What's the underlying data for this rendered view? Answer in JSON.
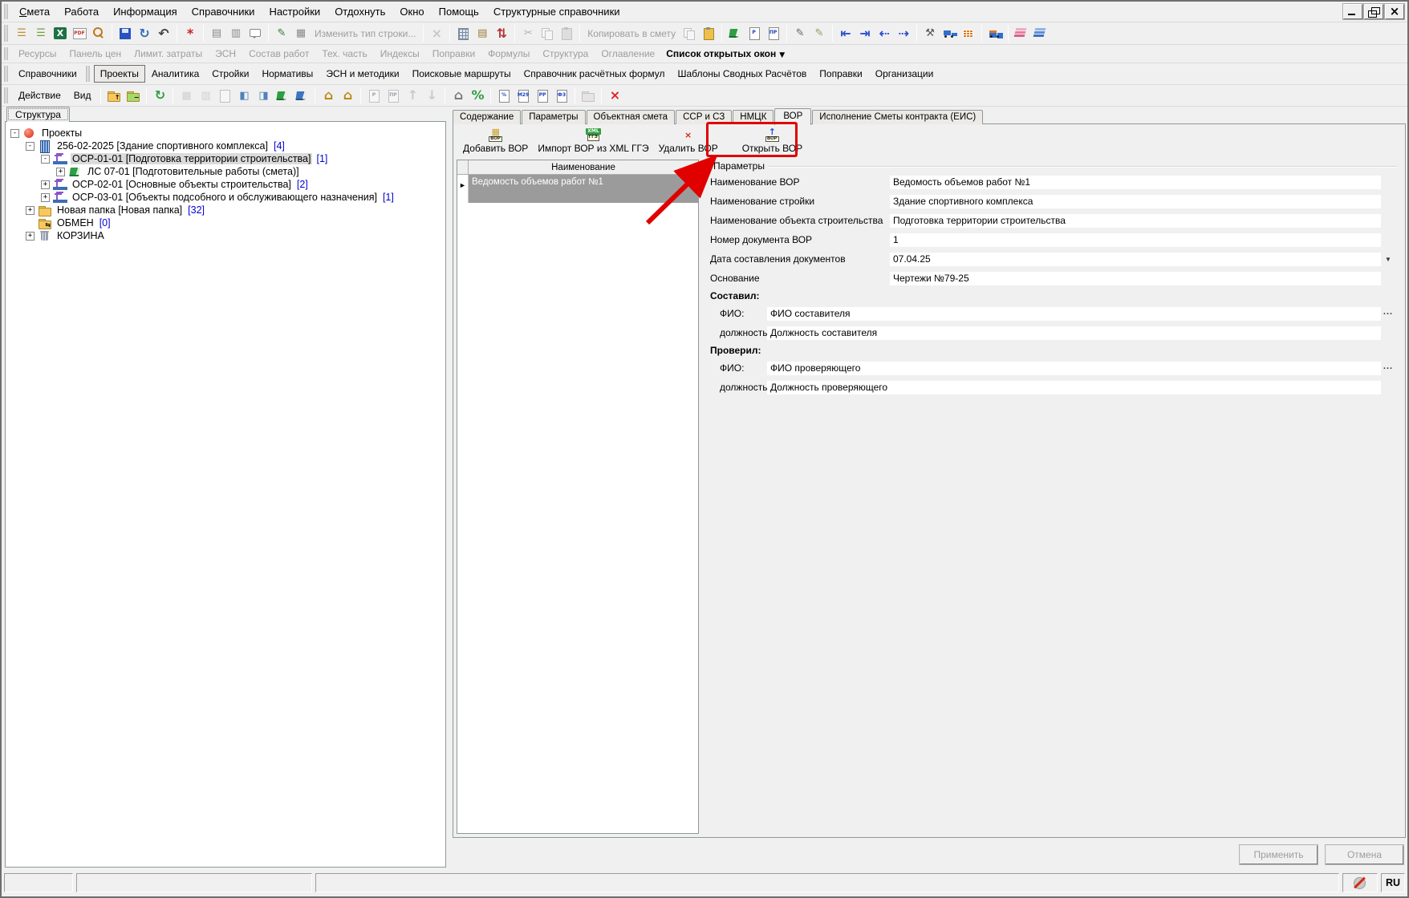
{
  "window": {
    "controls": [
      {
        "name": "minimize-button"
      },
      {
        "name": "restore-button"
      },
      {
        "name": "close-button"
      }
    ]
  },
  "menubar": {
    "items": [
      {
        "label": "Смета",
        "hotkey": true
      },
      {
        "label": "Работа"
      },
      {
        "label": "Информация"
      },
      {
        "label": "Справочники"
      },
      {
        "label": "Настройки"
      },
      {
        "label": "Отдохнуть"
      },
      {
        "label": "Окно"
      },
      {
        "label": "Помощь"
      },
      {
        "label": "Структурные справочники"
      }
    ]
  },
  "toolbar1": {
    "groups": [
      {
        "items": [
          {
            "icon": "tree-export-icon"
          },
          {
            "icon": "tree-import-icon"
          },
          {
            "icon": "excel-icon"
          },
          {
            "icon": "pdf-icon"
          },
          {
            "icon": "search-icon"
          }
        ]
      },
      {
        "items": [
          {
            "icon": "save-icon"
          },
          {
            "icon": "refresh-icon"
          },
          {
            "icon": "undo-icon"
          }
        ]
      },
      {
        "items": [
          {
            "icon": "recalc-icon"
          }
        ]
      },
      {
        "items": [
          {
            "icon": "row-settings-icon"
          },
          {
            "icon": "row-settings-alt-icon"
          },
          {
            "icon": "comment-icon"
          }
        ]
      },
      {
        "items": [
          {
            "icon": "globe-edit-icon"
          },
          {
            "icon": "building-copy-icon"
          },
          {
            "label": "Изменить тип строки...",
            "disabled": true
          }
        ]
      },
      {
        "items": [
          {
            "icon": "delete-row-icon",
            "disabled": true
          }
        ]
      },
      {
        "items": [
          {
            "icon": "calc-icon"
          },
          {
            "icon": "page-edit-icon"
          },
          {
            "icon": "updown-icon"
          }
        ]
      },
      {
        "items": [
          {
            "icon": "cut-icon",
            "disabled": true
          },
          {
            "icon": "copy-icon",
            "disabled": true
          },
          {
            "icon": "paste-icon",
            "disabled": true
          }
        ]
      },
      {
        "items": [
          {
            "label": "Копировать в смету",
            "disabled": true
          },
          {
            "icon": "copy-page-icon",
            "disabled": true
          },
          {
            "icon": "paste-orange-icon"
          }
        ]
      },
      {
        "items": [
          {
            "icon": "book-settings-icon"
          },
          {
            "icon": "page-p-icon",
            "letter": "P"
          },
          {
            "icon": "page-pr-icon",
            "letter": "ПР"
          }
        ]
      },
      {
        "items": [
          {
            "icon": "edit-list-icon"
          },
          {
            "icon": "edit-list-remove-icon"
          }
        ]
      },
      {
        "items": [
          {
            "icon": "level-up-icon"
          },
          {
            "icon": "level-down-icon"
          },
          {
            "icon": "outdent-icon"
          },
          {
            "icon": "indent-icon"
          }
        ]
      },
      {
        "items": [
          {
            "icon": "labor-icon"
          },
          {
            "icon": "machines-icon"
          },
          {
            "icon": "materials-icon"
          }
        ]
      },
      {
        "items": [
          {
            "icon": "delivery-icon"
          }
        ]
      },
      {
        "items": [
          {
            "icon": "books-pink-icon"
          },
          {
            "icon": "books-blue-icon"
          }
        ]
      }
    ]
  },
  "toolbar2": {
    "items": [
      "Ресурсы",
      "Панель цен",
      "Лимит. затраты",
      "ЭСН",
      "Состав работ",
      "Тех. часть",
      "Индексы",
      "Поправки",
      "Формулы",
      "Структура",
      "Оглавление"
    ],
    "open_windows": "Список открытых окон"
  },
  "main_tabs": {
    "items": [
      "Справочники",
      "Проекты",
      "Аналитика",
      "Стройки",
      "Нормативы",
      "ЭСН и методики",
      "Поисковые маршруты",
      "Справочник расчётных формул",
      "Шаблоны Сводных Расчётов",
      "Поправки",
      "Организации"
    ],
    "active": "Проекты"
  },
  "action_bar": {
    "menus": [
      "Действие",
      "Вид"
    ],
    "groups": [
      [
        {
          "icon": "folder-up-icon",
          "overlay": "↑"
        },
        {
          "icon": "folder-collapse-icon",
          "overlay": "−"
        }
      ],
      [
        {
          "icon": "refresh-green-icon"
        }
      ],
      [
        {
          "icon": "building-gray-icon",
          "disabled": true
        },
        {
          "icon": "columns-icon",
          "disabled": true
        },
        {
          "icon": "page-gray-icon",
          "disabled": true
        },
        {
          "icon": "window-edit-icon"
        },
        {
          "icon": "window-export-icon"
        },
        {
          "icon": "book-green-icon"
        },
        {
          "icon": "book-export-icon"
        }
      ],
      [
        {
          "icon": "house-add-icon"
        },
        {
          "icon": "house-copy-icon"
        }
      ],
      [
        {
          "icon": "page-p2-icon",
          "letter": "P",
          "disabled": true
        },
        {
          "icon": "page-pr2-icon",
          "letter": "ПР",
          "disabled": true
        },
        {
          "icon": "move-up-icon",
          "disabled": true
        },
        {
          "icon": "move-down-icon",
          "disabled": true
        }
      ],
      [
        {
          "icon": "house-percent-icon"
        },
        {
          "icon": "percent-gear-icon"
        }
      ],
      [
        {
          "icon": "percent-page-icon",
          "letter": "%"
        },
        {
          "icon": "m29-icon",
          "letter": "М29"
        },
        {
          "icon": "pp-icon",
          "letter": "РР"
        },
        {
          "icon": "fz-icon",
          "letter": "ФЗ"
        }
      ],
      [
        {
          "icon": "new-folder-icon",
          "disabled": true
        }
      ],
      [
        {
          "icon": "delete-red-icon"
        }
      ]
    ]
  },
  "left_panel": {
    "tab": "Структура",
    "tree": [
      {
        "depth": 0,
        "expander": "-",
        "icon": "projects-icon",
        "label": "Проекты",
        "count": ""
      },
      {
        "depth": 1,
        "expander": "-",
        "icon": "building-icon",
        "label": "256-02-2025 [Здание спортивного комплекса]",
        "count": "[4]"
      },
      {
        "depth": 2,
        "expander": "-",
        "icon": "object-icon",
        "label": "ОСР-01-01 [Подготовка территории строительства]",
        "count": "[1]",
        "selected": true
      },
      {
        "depth": 3,
        "expander": "+",
        "icon": "estimate-icon",
        "label": "ЛС 07-01 [Подготовительные работы (смета)]",
        "count": ""
      },
      {
        "depth": 2,
        "expander": "+",
        "icon": "object-icon",
        "label": "ОСР-02-01 [Основные объекты строительства]",
        "count": "[2]"
      },
      {
        "depth": 2,
        "expander": "+",
        "icon": "object-icon",
        "label": "ОСР-03-01 [Объекты подсобного и обслуживающего назначения]",
        "count": "[1]"
      },
      {
        "depth": 1,
        "expander": "+",
        "icon": "folder-icon",
        "label": "Новая папка [Новая папка]",
        "count": "[32]"
      },
      {
        "depth": 1,
        "expander": "",
        "icon": "exchange-icon",
        "label": "ОБМЕН",
        "count": "[0]"
      },
      {
        "depth": 1,
        "expander": "+",
        "icon": "trash-icon",
        "label": "КОРЗИНА",
        "count": ""
      }
    ]
  },
  "right_panel": {
    "tabs": [
      "Содержание",
      "Параметры",
      "Объектная смета",
      "ССР и СЗ",
      "НМЦК",
      "ВОР",
      "Исполнение Сметы контракта (ЕИС)"
    ],
    "active_tab": "ВОР",
    "vor_toolbar": [
      {
        "label": "Добавить ВОР",
        "icon": "vor-add-icon"
      },
      {
        "label": "Импорт ВОР из XML ГГЭ",
        "icon": "vor-import-icon"
      },
      {
        "label": "Удалить ВОР",
        "icon": "vor-delete-icon"
      },
      {
        "label": "Открыть ВОР",
        "icon": "vor-open-icon",
        "highlighted": true
      }
    ],
    "list": {
      "header": "Наименование",
      "rows": [
        {
          "text": "Ведомость объемов работ №1",
          "selected": true
        }
      ]
    },
    "form": {
      "title": "Параметры",
      "rows": [
        {
          "type": "field",
          "label": "Наименование ВОР",
          "value": "Ведомость объемов работ №1"
        },
        {
          "type": "field",
          "label": "Наименование стройки",
          "value": "Здание спортивного комплекса"
        },
        {
          "type": "field",
          "label": "Наименование объекта строительства",
          "value": "Подготовка территории строительства"
        },
        {
          "type": "field",
          "label": "Номер документа ВОР",
          "value": "1"
        },
        {
          "type": "field",
          "label": "Дата составления документов",
          "value": "07.04.25",
          "affordance": "dropdown"
        },
        {
          "type": "field",
          "label": "Основание",
          "value": "Чертежи №79-25"
        },
        {
          "type": "section",
          "label": "Составил:"
        },
        {
          "type": "field",
          "label": "ФИО:",
          "value": "ФИО составителя",
          "affordance": "ellipsis",
          "indent": true
        },
        {
          "type": "field",
          "label": "должность:",
          "value": "Должность составителя",
          "indent": true
        },
        {
          "type": "section",
          "label": "Проверил:"
        },
        {
          "type": "field",
          "label": "ФИО:",
          "value": "ФИО проверяющего",
          "affordance": "ellipsis",
          "indent": true
        },
        {
          "type": "field",
          "label": "должность:",
          "value": "Должность проверяющего",
          "indent": true
        }
      ]
    },
    "footer": {
      "apply": "Применить",
      "cancel": "Отмена",
      "enabled": false
    }
  },
  "statusbar": {
    "language": "RU"
  },
  "annotation": {
    "color": "#e00000"
  }
}
